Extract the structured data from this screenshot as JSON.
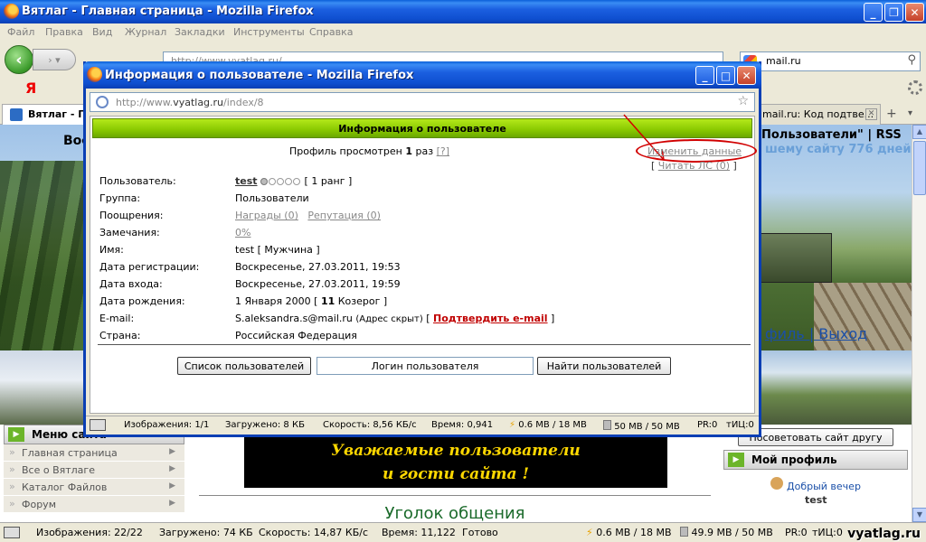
{
  "main_window": {
    "title": "Вятлаг - Главная страница - Mozilla Firefox",
    "menu": [
      "Файл",
      "Правка",
      "Вид",
      "Журнал",
      "Закладки",
      "Инструменты",
      "Справка"
    ],
    "url": "http://www.vyatlag.ru/",
    "search_value": "mail.ru",
    "yandex_label": "Я",
    "tabs": [
      {
        "label": "Вятлаг - Гл"
      },
      {
        "label": "mail.ru: Код подтве..."
      }
    ]
  },
  "page": {
    "welcome_text": "Вос",
    "users_link": "Пользователи\" | RSS",
    "days_text": "шему сайту 776 дней",
    "logout_text": "филь | Выход",
    "left_menu": {
      "title": "Меню сайта",
      "items": [
        "Главная страница",
        "Все о Вятлаге",
        "Каталог Файлов",
        "Форум"
      ]
    },
    "notice_line1": "Уважаемые пользователи",
    "notice_line2": "и гости сайта !",
    "corner_title": "Уголок общения",
    "advise_button": "Посоветовать сайт другу",
    "profile_title": "Мой профиль",
    "greeting": "Добрый вечер",
    "greeting_name": "test"
  },
  "main_status": {
    "images": "Изображения: 22/22",
    "loaded": "Загружено: 74 КБ",
    "speed": "Скорость: 14,87 КБ/с",
    "time": "Время: 11,122",
    "state": "Готово",
    "mem1": "0.6 MB / 18 MB",
    "mem2": "49.9 MB / 50 MB",
    "pr": "PR:0",
    "tic": "тИЦ:0",
    "watermark": "vyatlag.ru"
  },
  "popup": {
    "title": "Информация о пользователе - Mozilla Firefox",
    "url_prefix": "http://www.",
    "url_domain": "vyatlag.ru",
    "url_suffix": "/index/8",
    "header": "Информация о пользователе",
    "viewed_prefix": "Профиль просмотрен",
    "viewed_count": "1",
    "viewed_suffix": "раз",
    "viewed_help": "[?]",
    "edit_link": "Изменить данные",
    "read_pm": "Читать ЛС (0)",
    "fields": {
      "user_label": "Пользователь:",
      "user_name": "test",
      "user_rank": "[ 1 ранг ]",
      "group_label": "Группа:",
      "group_value": "Пользователи",
      "rewards_label": "Поощрения:",
      "rewards_value": "Награды (0)",
      "reputation_value": "Репутация (0)",
      "remarks_label": "Замечания:",
      "remarks_value": "0%",
      "name_label": "Имя:",
      "name_value": "test [ Мужчина ]",
      "reg_label": "Дата регистрации:",
      "reg_value": "Воскресенье, 27.03.2011, 19:53",
      "login_label": "Дата входа:",
      "login_value": "Воскресенье, 27.03.2011, 19:59",
      "birth_label": "Дата рождения:",
      "birth_value_pre": "1 Января 2000 [",
      "birth_age": "11",
      "birth_value_post": "Козерог ]",
      "email_label": "E-mail:",
      "email_value": "S.aleksandra.s@mail.ru",
      "email_hidden": "(Адрес скрыт)",
      "email_confirm": "Подтвердить e-mail",
      "country_label": "Страна:",
      "country_value": "Российская Федерация"
    },
    "buttons": {
      "user_list": "Список пользователей",
      "login_input": "Логин пользователя",
      "find_users": "Найти пользователей"
    },
    "status": {
      "images": "Изображения: 1/1",
      "loaded": "Загружено: 8 КБ",
      "speed": "Скорость: 8,56 КБ/с",
      "time": "Время: 0,941",
      "mem1": "0.6 MB / 18 MB",
      "mem2": "50 MB / 50 MB",
      "pr": "PR:0",
      "tic": "тИЦ:0"
    }
  }
}
